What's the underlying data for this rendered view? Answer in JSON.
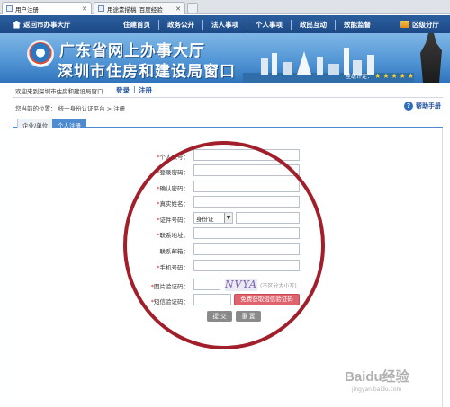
{
  "browser": {
    "tabs": [
      {
        "label": "用户注册"
      },
      {
        "label": "用途素描稿_百度经验"
      }
    ]
  },
  "nav": {
    "home": "返回市办事大厅",
    "items": [
      "住建首页",
      "政务公开",
      "法人事项",
      "个人事项",
      "政民互动",
      "效能监督"
    ],
    "branch": "区级分厅"
  },
  "banner": {
    "title": "广东省网上办事大厅",
    "subtitle": "深圳市住房和建设局窗口",
    "rating_label": "星级评定："
  },
  "header": {
    "welcome": "欢迎来到深圳市住房和建设局窗口",
    "login": "登录",
    "separator": "|",
    "register": "注册",
    "location": "您当前的位置： 统一身份认证平台 > 注册",
    "help": "帮助手册"
  },
  "form_tabs": [
    "企业/单位",
    "个人注册"
  ],
  "form": {
    "fields": [
      {
        "label": "个人账号：",
        "required": true
      },
      {
        "label": "登录密码：",
        "required": true
      },
      {
        "label": "确认密码：",
        "required": true
      },
      {
        "label": "真实姓名：",
        "required": true
      },
      {
        "label": "证件号码：",
        "required": true,
        "select_value": "身份证"
      },
      {
        "label": "联系地址：",
        "required": true
      },
      {
        "label": "联系邮箱：",
        "required": false
      },
      {
        "label": "手机号码：",
        "required": true
      },
      {
        "label": "图片验证码：",
        "required": true
      },
      {
        "label": "短信验证码：",
        "required": true
      }
    ],
    "captcha_text": "NVYA",
    "captcha_hint": "(不区分大小写)",
    "sms_button": "免费获取短信验证码",
    "submit": "提 交",
    "reset": "重 置"
  },
  "watermark": {
    "text": "Baidu经验",
    "url": "jingyan.baidu.com"
  }
}
